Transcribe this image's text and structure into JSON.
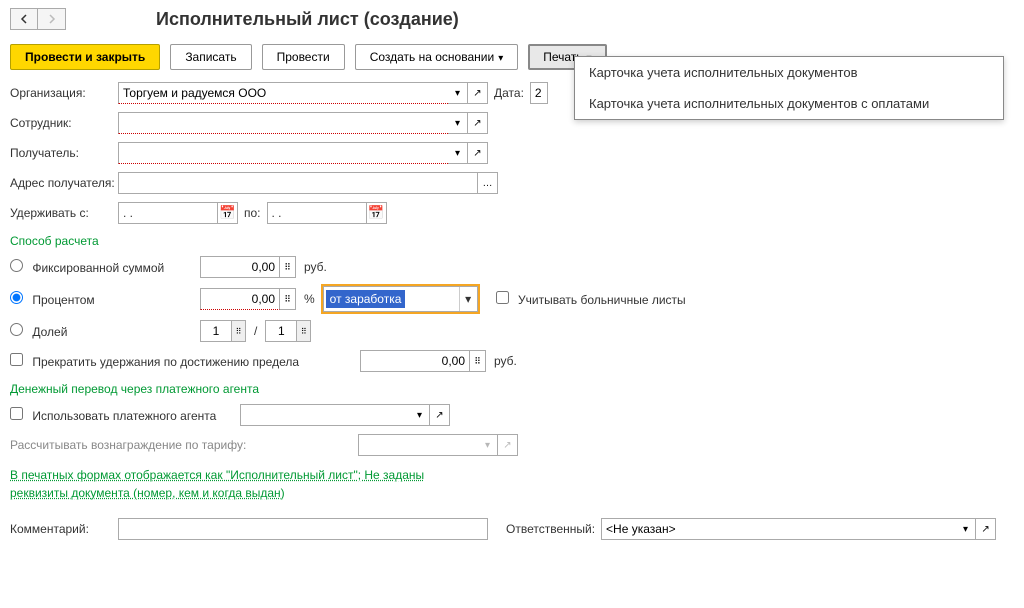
{
  "header": {
    "title": "Исполнительный лист (создание)"
  },
  "toolbar": {
    "post_close": "Провести и закрыть",
    "write": "Записать",
    "post": "Провести",
    "create_based": "Создать на основании",
    "print": "Печать"
  },
  "print_menu": {
    "item1": "Карточка учета исполнительных документов",
    "item2": "Карточка учета исполнительных документов с оплатами"
  },
  "fields": {
    "org_label": "Организация:",
    "org_value": "Торгуем и радуемся ООО",
    "date_label": "Дата:",
    "date_value": "2",
    "employee_label": "Сотрудник:",
    "employee_value": "",
    "recipient_label": "Получатель:",
    "recipient_value": "",
    "recipient_addr_label": "Адрес получателя:",
    "recipient_addr_value": "",
    "hold_from_label": "Удерживать с:",
    "hold_from": ". .",
    "hold_to_label": "по:",
    "hold_to": ". ."
  },
  "calc": {
    "section": "Способ расчета",
    "fixed_label": "Фиксированной суммой",
    "fixed_value": "0,00",
    "fixed_unit": "руб.",
    "percent_label": "Процентом",
    "percent_value": "0,00",
    "percent_unit": "%",
    "percent_base": "от заработка",
    "sick_label": "Учитывать больничные листы",
    "fraction_label": "Долей",
    "fraction_num": "1",
    "fraction_den": "1",
    "stop_label": "Прекратить удержания по достижению предела",
    "stop_value": "0,00",
    "stop_unit": "руб."
  },
  "agent": {
    "section": "Денежный перевод через платежного агента",
    "use_label": "Использовать платежного агента",
    "tariff_label": "Рассчитывать вознаграждение по тарифу:"
  },
  "link": {
    "text": "В печатных формах отображается как \"Исполнительный лист\"; Не заданы реквизиты документа (номер, кем и когда выдан)"
  },
  "footer": {
    "comment_label": "Комментарий:",
    "comment_value": "",
    "responsible_label": "Ответственный:",
    "responsible_value": "<Не указан>"
  }
}
